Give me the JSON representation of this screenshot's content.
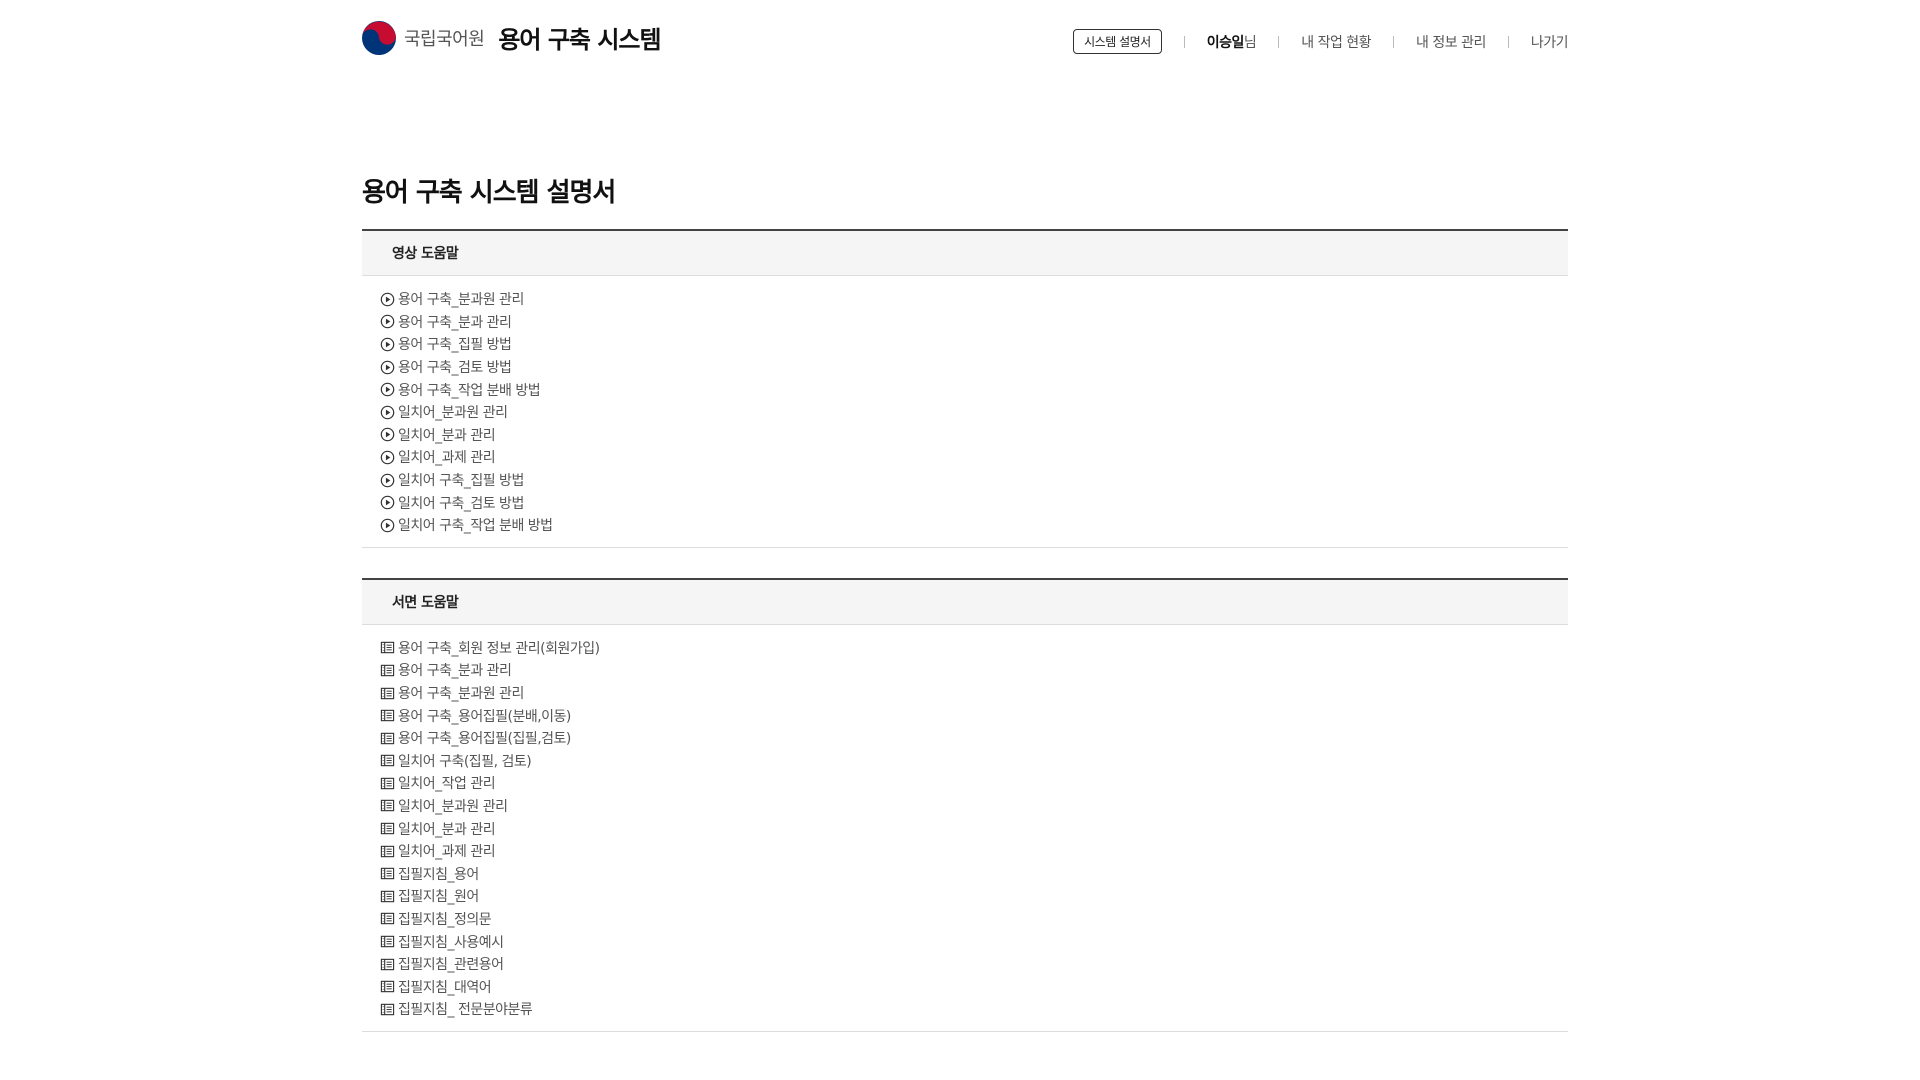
{
  "header": {
    "org_name": "국립국어원",
    "system_name": "용어 구축 시스템",
    "nav": {
      "manual_label": "시스템 설명서",
      "user_name": "이승일",
      "user_suffix": "님",
      "my_work": "내 작업 현황",
      "my_info": "내 정보 관리",
      "exit": "나가기"
    }
  },
  "page_title": "용어 구축 시스템 설명서",
  "video_help": {
    "title": "영상 도움말",
    "icon": "play-circle-icon",
    "items": [
      "용어 구축_분과원 관리",
      "용어 구축_분과 관리",
      "용어 구축_집필 방법",
      "용어 구축_검토 방법",
      "용어 구축_작업 분배 방법",
      "일치어_분과원 관리",
      "일치어_분과 관리",
      "일치어_과제 관리",
      "일치어 구축_집필 방법",
      "일치어 구축_검토 방법",
      "일치어 구축_작업 분배 방법"
    ]
  },
  "document_help": {
    "title": "서면 도움말",
    "icon": "document-icon",
    "items": [
      "용어 구축_회원 정보 관리(회원가입)",
      "용어 구축_분과 관리",
      "용어 구축_분과원 관리",
      "용어 구축_용어집필(분배,이동)",
      "용어 구축_용어집필(집필,검토)",
      "일치어 구축(집필, 검토)",
      "일치어_작업 관리",
      "일치어_분과원 관리",
      "일치어_분과 관리",
      "일치어_과제 관리",
      "집필지침_용어",
      "집필지침_원어",
      "집필지침_정의문",
      "집필지침_사용예시",
      "집필지침_관련용어",
      "집필지침_대역어",
      "집필지침_ 전문분야분류"
    ]
  },
  "colors": {
    "logo_red": "#c60c30",
    "logo_blue": "#003478",
    "section_bg": "#f5f5f5"
  }
}
